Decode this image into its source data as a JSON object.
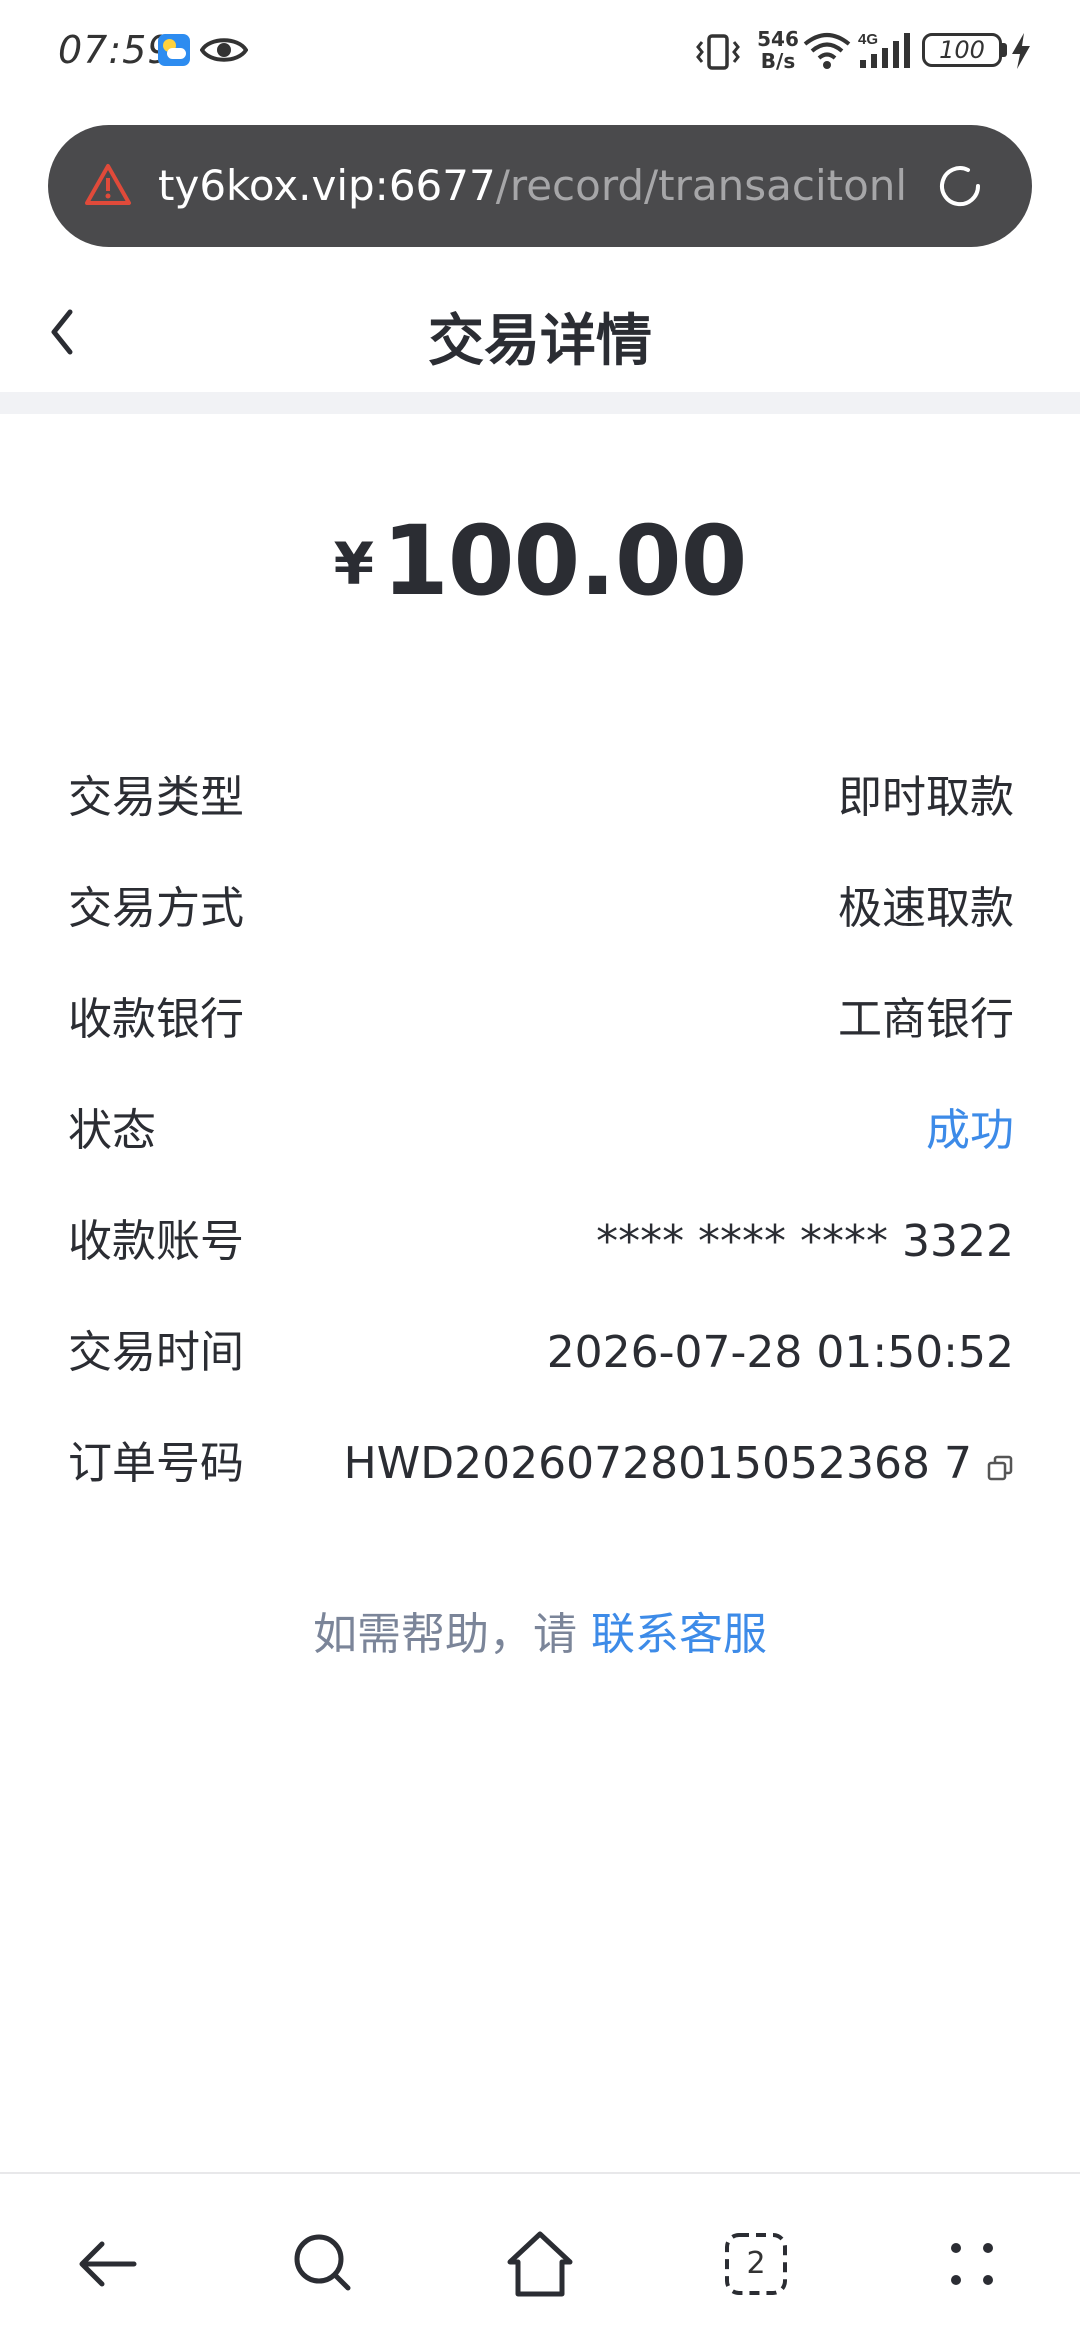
{
  "status_bar": {
    "time": "07:59",
    "net_speed_value": "546",
    "net_speed_unit": "B/s",
    "signal_type": "4G",
    "battery": "100",
    "icons": [
      "weather-icon",
      "eye-icon",
      "vibrate-icon",
      "wifi-icon",
      "signal-icon",
      "battery-icon",
      "charging-icon"
    ]
  },
  "browser": {
    "url_host": "ty6kox.vip:6677",
    "url_path": "/record/transacitonl"
  },
  "header": {
    "title": "交易详情"
  },
  "amount": {
    "currency": "¥",
    "value": "100.00"
  },
  "details": [
    {
      "label": "交易类型",
      "value": "即时取款"
    },
    {
      "label": "交易方式",
      "value": "极速取款"
    },
    {
      "label": "收款银行",
      "value": "工商银行"
    },
    {
      "label": "状态",
      "value": "成功"
    },
    {
      "label": "收款账号",
      "value": "**** **** **** 3322"
    },
    {
      "label": "交易时间",
      "value": "2026-07-28 01:50:52"
    },
    {
      "label": "订单号码",
      "value": "HWD20260728015052368 7"
    }
  ],
  "help": {
    "text": "如需帮助，请 ",
    "link": "联系客服"
  },
  "bottom_nav": {
    "tab_count": "2"
  },
  "colors": {
    "success": "#3d8be8",
    "link": "#3d8be8",
    "url_bar": "#4a4a4c",
    "warning": "#e04a3a"
  }
}
